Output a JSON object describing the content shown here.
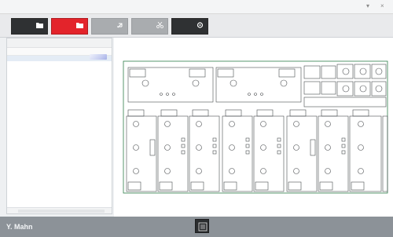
{
  "window": {
    "title": "",
    "minimize_glyph": "▾",
    "close_glyph": "×"
  },
  "toolbar": {
    "buttons": [
      {
        "label": "",
        "icon": "folder-icon",
        "style": "dark"
      },
      {
        "label": "",
        "icon": "folder-icon",
        "style": "red"
      },
      {
        "label": "",
        "icon": "export-icon",
        "style": "gray"
      },
      {
        "label": "",
        "icon": "scissors-icon",
        "style": "gray"
      },
      {
        "label": "",
        "icon": "gear-icon",
        "style": "dark"
      }
    ]
  },
  "side_panel": {
    "title": "",
    "columns": [
      "",
      "",
      ""
    ],
    "rows": [
      {
        "cells": [
          "",
          "",
          ""
        ],
        "selected": true
      },
      {
        "cells": [
          "",
          "",
          ""
        ],
        "selected": false
      }
    ],
    "footer_label": ""
  },
  "status_bar": {
    "brand": "Y. Mahn",
    "action_icon": "stack-icon"
  },
  "colors": {
    "accent_red": "#e3242b",
    "toolbar_dark": "#2f3133",
    "statusbar": "#8c9298"
  }
}
